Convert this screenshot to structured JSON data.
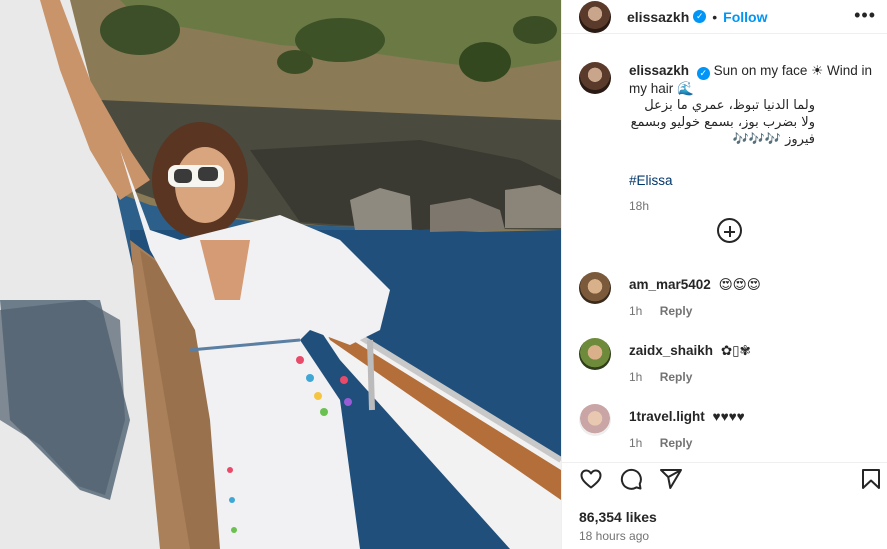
{
  "post": {
    "username": "elissazkh",
    "verified_mark": "✓",
    "dot": "•",
    "follow_label": "Follow",
    "more_label": "•••"
  },
  "caption": {
    "username": "elissazkh",
    "text": "Sun on my face ☀ Wind in my hair 🌊",
    "arabic": "ولما الدنيا تبوظ، عمري ما بزعل ولا بضرب بوز، بسمع خوليو وبسمع فيروز 🎶🎶🎶",
    "hashtag": "#Elissa",
    "time": "18h"
  },
  "comments": [
    {
      "username": "am_mar5402",
      "text": "😍😍😍",
      "time": "1h",
      "reply": "Reply"
    },
    {
      "username": "zaidx_shaikh",
      "text": "✿▯✾",
      "time": "1h",
      "reply": "Reply"
    },
    {
      "username": "1travel.light",
      "text": "♥♥♥♥",
      "time": "1h",
      "reply": "Reply"
    }
  ],
  "actions": {
    "icons": [
      "heart-icon",
      "comment-icon",
      "share-icon",
      "bookmark-icon"
    ],
    "likes": "86,354 likes",
    "time_ago": "18 hours ago"
  },
  "colors": {
    "accent": "#0095f6",
    "hashtag": "#00376b",
    "muted": "#737373",
    "text": "#262626"
  }
}
